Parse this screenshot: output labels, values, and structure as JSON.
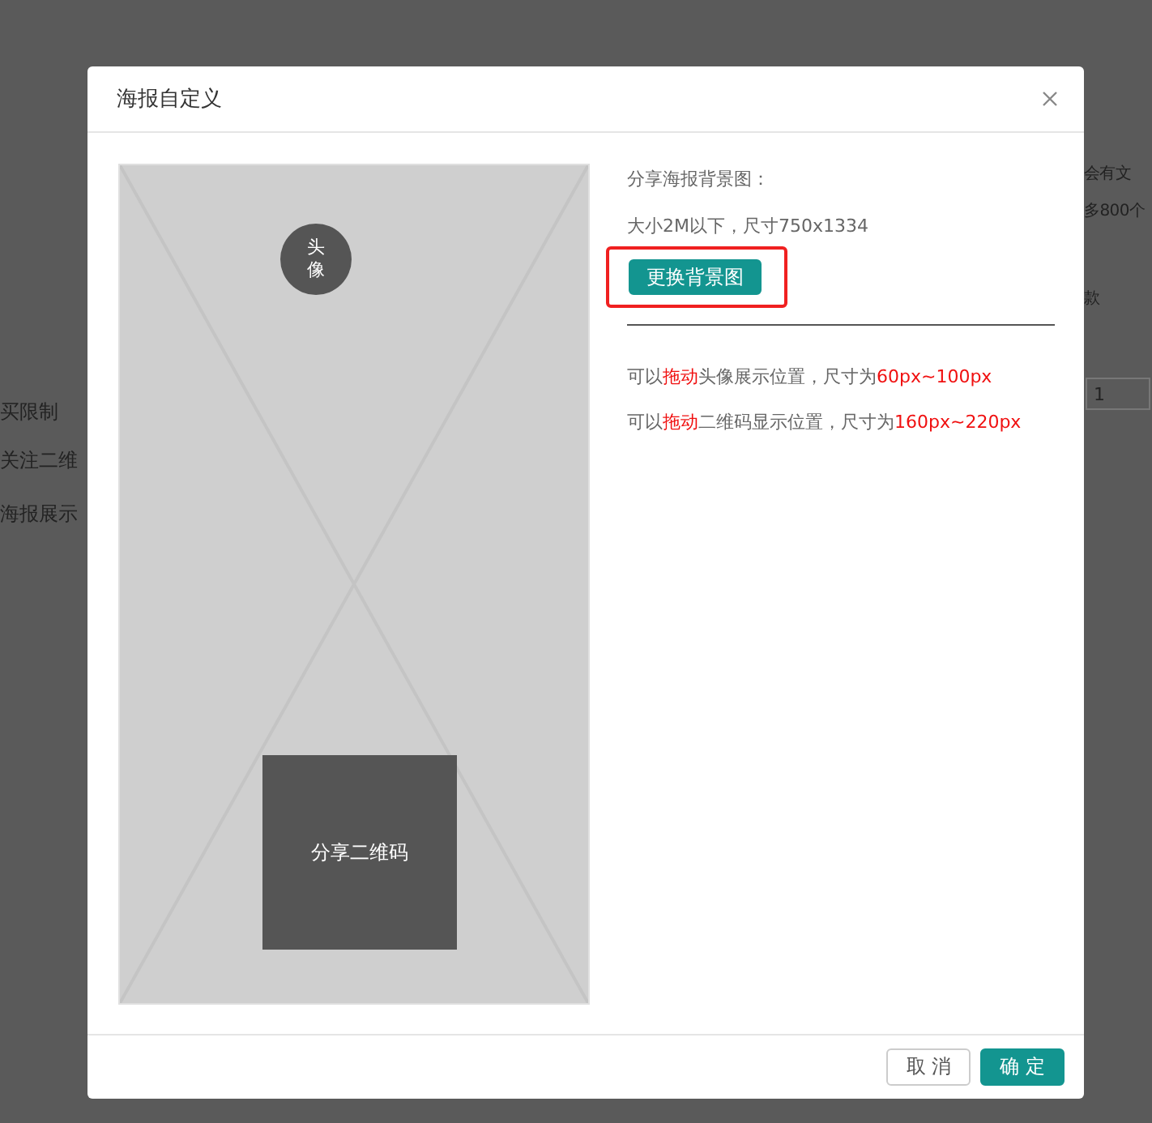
{
  "background": {
    "left_labels": [
      "买限制",
      "关注二维",
      "海报展示"
    ],
    "right_labels": [
      "会有文",
      "多800个",
      "款"
    ],
    "right_field_value": "1"
  },
  "dialog": {
    "title": "海报自定义",
    "preview": {
      "avatar_label": "头像",
      "qr_label": "分享二维码"
    },
    "heading": "分享海报背景图：",
    "size_note": "大小2M以下，尺寸750x1334",
    "change_button": "更换背景图",
    "hints": [
      [
        {
          "text": "可以",
          "highlight": false
        },
        {
          "text": "拖动",
          "highlight": true
        },
        {
          "text": "头像展示位置，尺寸为",
          "highlight": false
        },
        {
          "text": "60px~100px",
          "highlight": true
        }
      ],
      [
        {
          "text": "可以",
          "highlight": false
        },
        {
          "text": "拖动",
          "highlight": true
        },
        {
          "text": "二维码显示位置，尺寸为",
          "highlight": false
        },
        {
          "text": "160px~220px",
          "highlight": true
        }
      ]
    ],
    "buttons": [
      {
        "label": "取 消",
        "kind": "secondary"
      },
      {
        "label": "确 定",
        "kind": "primary"
      }
    ]
  }
}
